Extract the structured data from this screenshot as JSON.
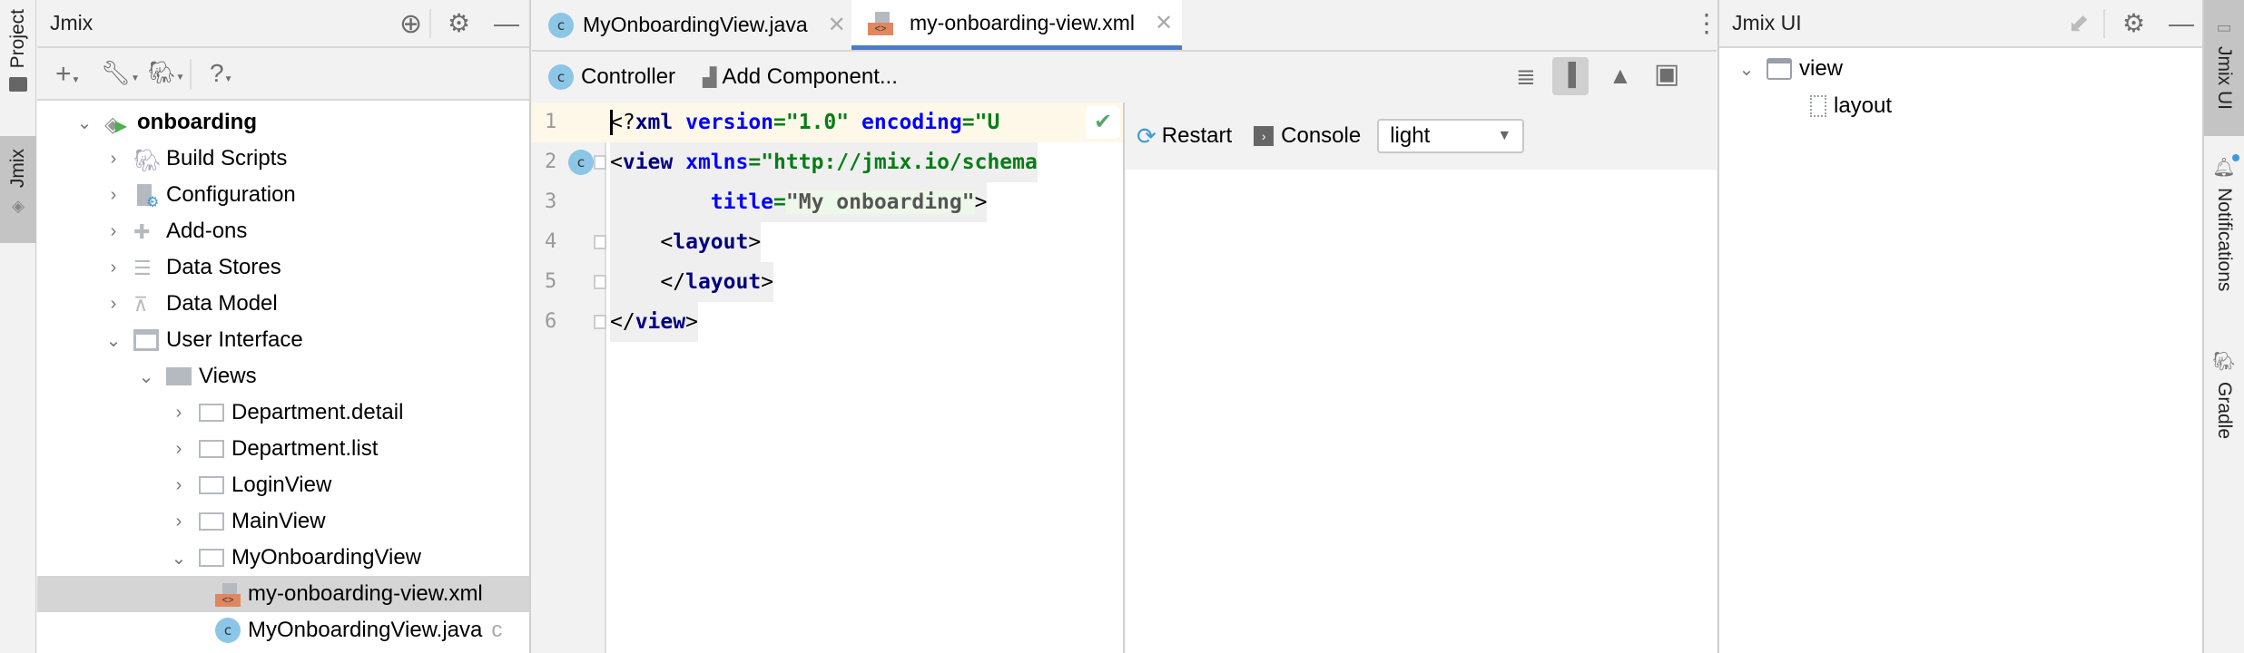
{
  "left_strip": {
    "tabs": [
      {
        "label": "Project",
        "icon": "folder-icon"
      },
      {
        "label": "Jmix",
        "icon": "jmix-icon",
        "active": true
      }
    ]
  },
  "project_panel": {
    "title": "Jmix",
    "header_icons": [
      "locate-icon",
      "gear-icon",
      "minimize-icon"
    ],
    "toolbar_icons": [
      "add-icon",
      "wrench-icon",
      "gradle-icon",
      "help-icon"
    ],
    "tree": [
      {
        "label": "onboarding",
        "bold": true,
        "expanded": true
      },
      {
        "label": "Build Scripts"
      },
      {
        "label": "Configuration"
      },
      {
        "label": "Add-ons"
      },
      {
        "label": "Data Stores"
      },
      {
        "label": "Data Model"
      },
      {
        "label": "User Interface",
        "expanded": true
      },
      {
        "label": "Views",
        "expanded": true
      },
      {
        "label": "Department.detail"
      },
      {
        "label": "Department.list"
      },
      {
        "label": "LoginView"
      },
      {
        "label": "MainView"
      },
      {
        "label": "MyOnboardingView",
        "expanded": true
      },
      {
        "label": "my-onboarding-view.xml",
        "selected": true
      },
      {
        "label": "MyOnboardingView.java",
        "suffix": "c"
      }
    ]
  },
  "editor": {
    "tabs": [
      {
        "label": "MyOnboardingView.java",
        "active": false
      },
      {
        "label": "my-onboarding-view.xml",
        "active": true
      }
    ],
    "toolbar": {
      "controller": "Controller",
      "add_component": "Add Component..."
    },
    "view_mode_icons": [
      "text-only-icon",
      "split-icon",
      "preview-icon",
      "preview-frame-icon"
    ],
    "code_lines": [
      [
        {
          "t": "<?",
          "c": "p"
        },
        {
          "t": "xml ",
          "c": "tag"
        },
        {
          "t": "version",
          "c": "attr"
        },
        {
          "t": "=\"1.0\" ",
          "c": "val"
        },
        {
          "t": "encoding",
          "c": "attr"
        },
        {
          "t": "=\"U",
          "c": "val"
        }
      ],
      [
        {
          "t": "<",
          "c": "p"
        },
        {
          "t": "view ",
          "c": "tag"
        },
        {
          "t": "xmlns",
          "c": "attr"
        },
        {
          "t": "=\"http://jmix.io/schema",
          "c": "val"
        }
      ],
      [
        {
          "t": "        ",
          "c": "p"
        },
        {
          "t": "title",
          "c": "attr"
        },
        {
          "t": "=",
          "c": "val"
        },
        {
          "t": "\"My onboarding\"",
          "c": "str"
        },
        {
          "t": ">",
          "c": "p"
        }
      ],
      [
        {
          "t": "    <",
          "c": "p"
        },
        {
          "t": "layout",
          "c": "tag"
        },
        {
          "t": ">",
          "c": "p"
        }
      ],
      [
        {
          "t": "    </",
          "c": "p"
        },
        {
          "t": "layout",
          "c": "tag"
        },
        {
          "t": ">",
          "c": "p"
        }
      ],
      [
        {
          "t": "</",
          "c": "p"
        },
        {
          "t": "view",
          "c": "tag"
        },
        {
          "t": ">",
          "c": "p"
        }
      ]
    ],
    "line_numbers": [
      "1",
      "2",
      "3",
      "4",
      "5",
      "6"
    ],
    "preview_toolbar": {
      "restart": "Restart",
      "console": "Console",
      "theme_select": "light"
    }
  },
  "jmix_ui_panel": {
    "title": "Jmix UI",
    "tree": [
      {
        "label": "view",
        "expanded": true
      },
      {
        "label": "layout"
      }
    ]
  },
  "right_strip": {
    "tabs": [
      {
        "label": "Jmix UI",
        "active": true
      },
      {
        "label": "Notifications"
      },
      {
        "label": "Gradle"
      }
    ]
  },
  "colors": {
    "accent": "#4d7cc6",
    "xml_tag": "#000080",
    "xml_attr": "#0000ff",
    "xml_value": "#067d17",
    "class_icon": "#8cc6e6",
    "xml_file_icon": "#e0875f"
  }
}
